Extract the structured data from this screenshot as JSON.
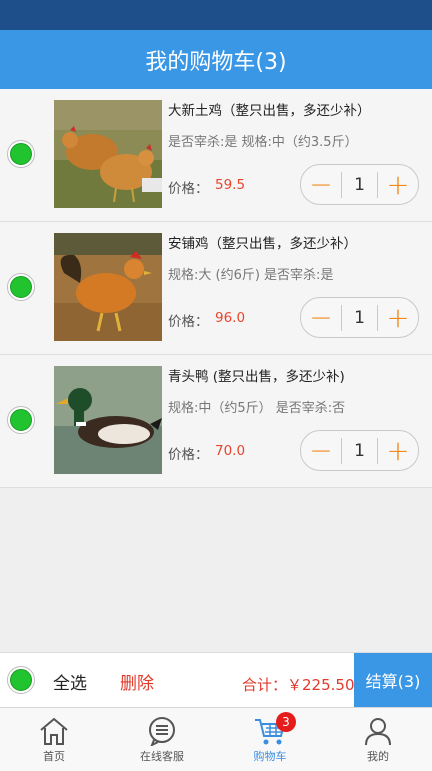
{
  "header": {
    "title": "我的购物车(3)"
  },
  "cart": {
    "items": [
      {
        "name": "大新土鸡（整只出售，多还少补）",
        "spec": "是否宰杀:是 规格:中（约3.5斤）",
        "price_label": "价格：",
        "price": "59.5",
        "quantity": "1",
        "minus": "−",
        "plus": "+",
        "selected": true,
        "image": "chicken-pair-icon"
      },
      {
        "name": "安铺鸡（整只出售，多还少补）",
        "spec": "规格:大 (约6斤) 是否宰杀:是",
        "price_label": "价格：",
        "price": "96.0",
        "quantity": "1",
        "minus": "−",
        "plus": "+",
        "selected": true,
        "image": "rooster-icon"
      },
      {
        "name": "青头鸭 (整只出售，多还少补)",
        "spec": "规格:中（约5斤） 是否宰杀:否",
        "price_label": "价格：",
        "price": "70.0",
        "quantity": "1",
        "minus": "−",
        "plus": "+",
        "selected": true,
        "image": "mallard-duck-icon"
      }
    ]
  },
  "checkout": {
    "select_all": "全选",
    "delete": "删除",
    "total": "合计：￥225.50",
    "submit": "结算(3)"
  },
  "tabs": [
    {
      "label": "首页",
      "icon": "home-icon"
    },
    {
      "label": "在线客服",
      "icon": "chat-icon"
    },
    {
      "label": "购物车",
      "icon": "cart-icon",
      "badge": "3",
      "active": true
    },
    {
      "label": "我的",
      "icon": "user-icon"
    }
  ],
  "colors": {
    "primary": "#3a97e6",
    "status_bar": "#1e4f8a",
    "price": "#e8452c",
    "accent_orange": "#f28a1e",
    "check_green": "#21c42e",
    "badge": "#e51c1c"
  }
}
